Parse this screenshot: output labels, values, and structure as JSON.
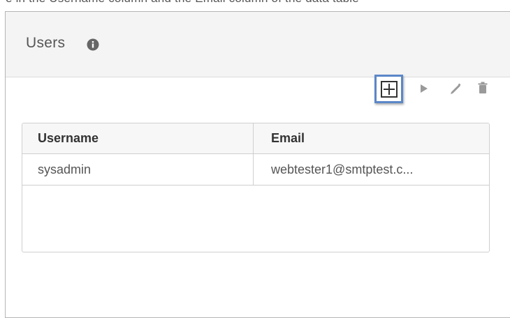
{
  "page": {
    "top_strip_text": "e in the Username column and the Email column of the data table"
  },
  "panel": {
    "title": "Users",
    "info_icon": "info-circle-icon"
  },
  "toolbar": {
    "add_icon": "plus-icon",
    "run_icon": "play-icon",
    "edit_icon": "pencil-icon",
    "delete_icon": "trash-icon",
    "highlight_color": "#5b87c8"
  },
  "table": {
    "columns": [
      "Username",
      "Email"
    ],
    "rows": [
      {
        "username": "sysadmin",
        "email": "webtester1@smtptest.c..."
      }
    ]
  }
}
